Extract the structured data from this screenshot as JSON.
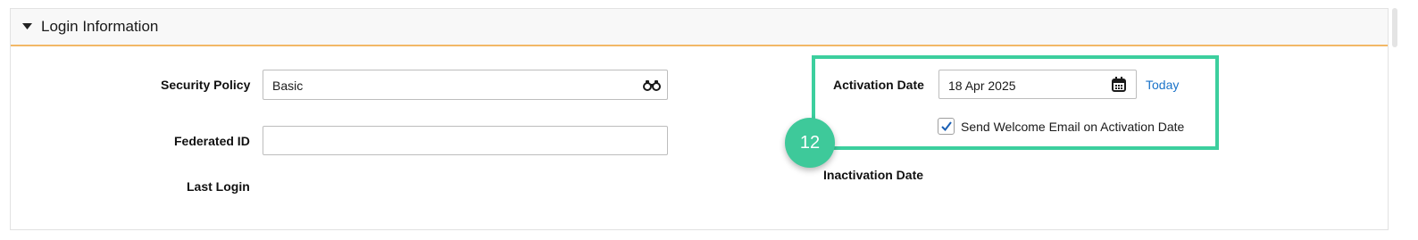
{
  "section": {
    "title": "Login Information"
  },
  "security_policy": {
    "label": "Security Policy",
    "value": "Basic",
    "lookup_icon": "binoculars-icon"
  },
  "federated_id": {
    "label": "Federated ID",
    "value": ""
  },
  "last_login": {
    "label": "Last Login"
  },
  "activation_date": {
    "label": "Activation Date",
    "value": "18 Apr 2025",
    "calendar_icon": "calendar-icon",
    "today_link": "Today"
  },
  "welcome_email": {
    "label": "Send Welcome Email on Activation Date",
    "checked": true
  },
  "inactivation_date": {
    "label": "Inactivation Date"
  },
  "callout": {
    "number": "12"
  },
  "colors": {
    "accent_border": "#f2b866",
    "highlight": "#3ccf9e",
    "badge": "#3ec99a",
    "link": "#1a73c9"
  }
}
